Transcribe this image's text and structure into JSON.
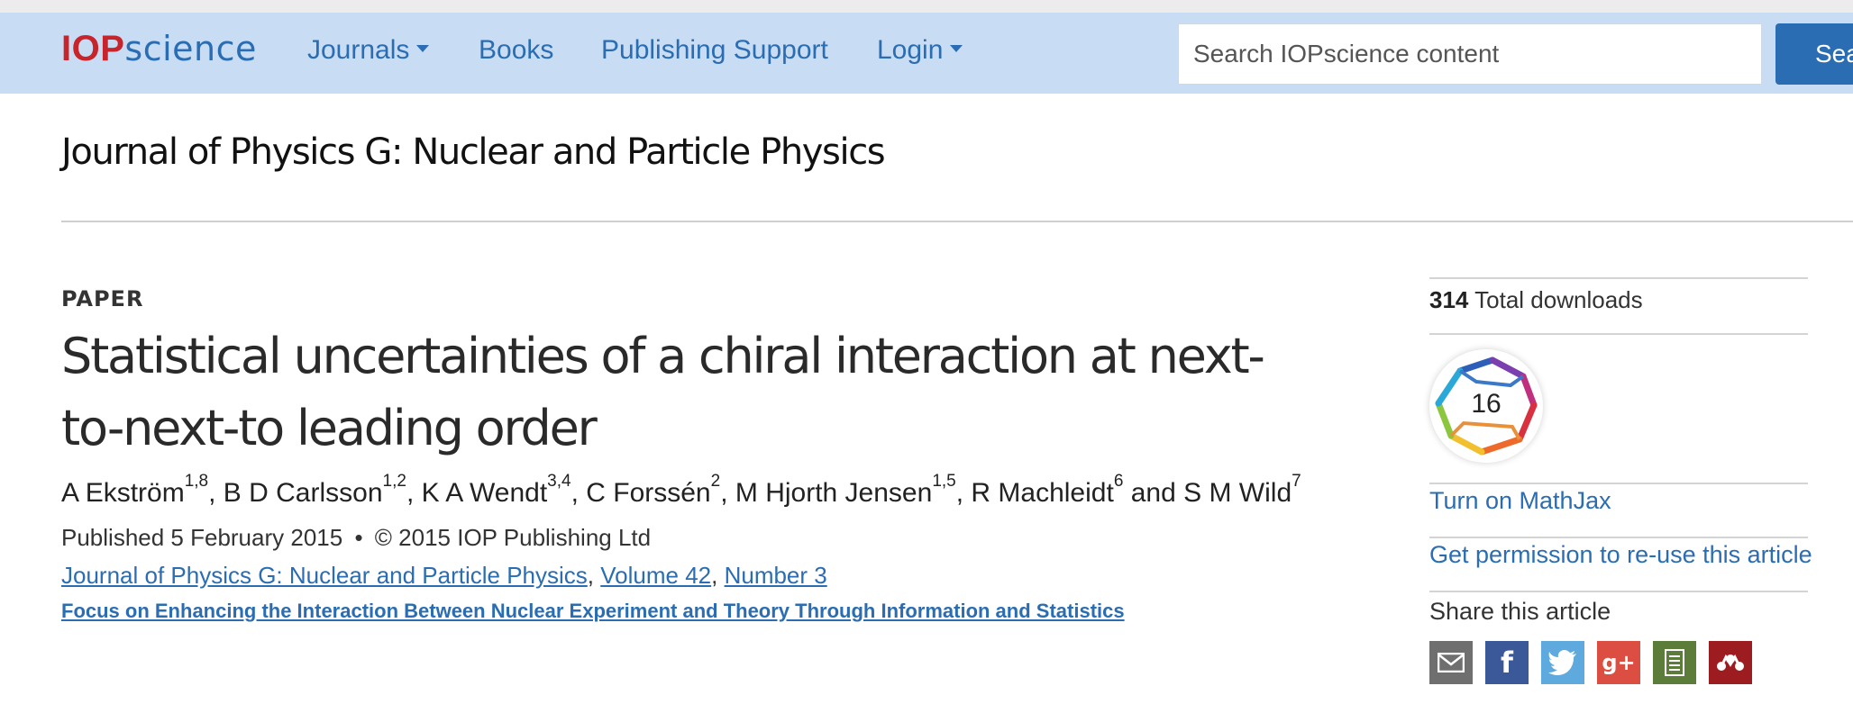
{
  "header": {
    "logo_part1": "IOP",
    "logo_part2": "science",
    "nav": {
      "journals": "Journals",
      "books": "Books",
      "publishing_support": "Publishing Support",
      "login": "Login"
    },
    "search": {
      "placeholder": "Search IOPscience content",
      "button_label": "Search"
    }
  },
  "journal_title": "Journal of Physics G: Nuclear and Particle Physics",
  "article": {
    "type_label": "PAPER",
    "title": "Statistical uncertainties of a chiral interaction at next-to-next-to leading order",
    "authors": [
      {
        "name": "A Ekström",
        "affil": "1,8",
        "sep": ", "
      },
      {
        "name": "B D Carlsson",
        "affil": "1,2",
        "sep": ", "
      },
      {
        "name": "K A Wendt",
        "affil": "3,4",
        "sep": ", "
      },
      {
        "name": "C Forssén",
        "affil": "2",
        "sep": ", "
      },
      {
        "name": "M Hjorth Jensen",
        "affil": "1,5",
        "sep": ", "
      },
      {
        "name": "R Machleidt",
        "affil": "6",
        "sep": " and "
      },
      {
        "name": "S M Wild",
        "affil": "7",
        "sep": ""
      }
    ],
    "published": "Published 5 February 2015",
    "bullet": "•",
    "copyright": "© 2015 IOP Publishing Ltd",
    "citation": {
      "journal": "Journal of Physics G: Nuclear and Particle Physics",
      "volume": "Volume 42",
      "number": "Number 3"
    },
    "collection": "Focus on Enhancing the Interaction Between Nuclear Experiment and Theory Through Information and Statistics"
  },
  "sidebar": {
    "downloads_count": "314",
    "downloads_label": "Total downloads",
    "citation_badge_value": "16",
    "mathjax_link": "Turn on MathJax",
    "permission_link": "Get permission to re-use this article",
    "share_label": "Share this article",
    "share_buttons": [
      {
        "icon": "email-icon",
        "color": "#6f6f6f"
      },
      {
        "icon": "facebook-icon",
        "color": "#3b5998"
      },
      {
        "icon": "twitter-icon",
        "color": "#5ea9dd"
      },
      {
        "icon": "google-plus-icon",
        "color": "#dc4e41"
      },
      {
        "icon": "citeulike-icon",
        "color": "#5c7c3a"
      },
      {
        "icon": "mendeley-icon",
        "color": "#9d1c1f"
      }
    ]
  },
  "colors": {
    "brand_red": "#c7252b",
    "link_blue": "#2a6db3",
    "navbar_bg": "#c8dcf3"
  }
}
